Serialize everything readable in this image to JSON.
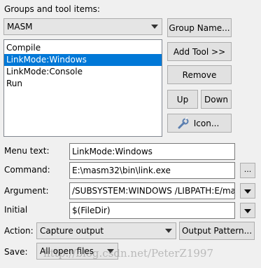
{
  "groups_label": "Groups and tool items:",
  "group_select": {
    "value": "MASM"
  },
  "group_name_button": "Group Name...",
  "tool_list": {
    "items": [
      "Compile",
      "LinkMode:Windows",
      "LinkMode:Console",
      "Run"
    ],
    "selected_index": 1
  },
  "buttons": {
    "add_tool": "Add Tool >>",
    "remove": "Remove",
    "up": "Up",
    "down": "Down",
    "icon": "Icon..."
  },
  "fields": {
    "menu_text": {
      "label": "Menu text:",
      "value": "LinkMode:Windows"
    },
    "command": {
      "label": "Command:",
      "value": "E:\\masm32\\bin\\link.exe"
    },
    "argument": {
      "label": "Argument:",
      "value": "/SUBSYSTEM:WINDOWS /LIBPATH:E/ma"
    },
    "initial": {
      "label": "Initial",
      "value": "$(FileDir)"
    }
  },
  "browse_label": "...",
  "action": {
    "label": "Action:",
    "value": "Capture output",
    "pattern_button": "Output Pattern..."
  },
  "save": {
    "label": "Save:",
    "value": "All open files"
  },
  "watermark": "http://blog.csdn.net/PeterZ1997",
  "colors": {
    "selection": "#0078d7",
    "window_bg": "#f0f0f0"
  }
}
